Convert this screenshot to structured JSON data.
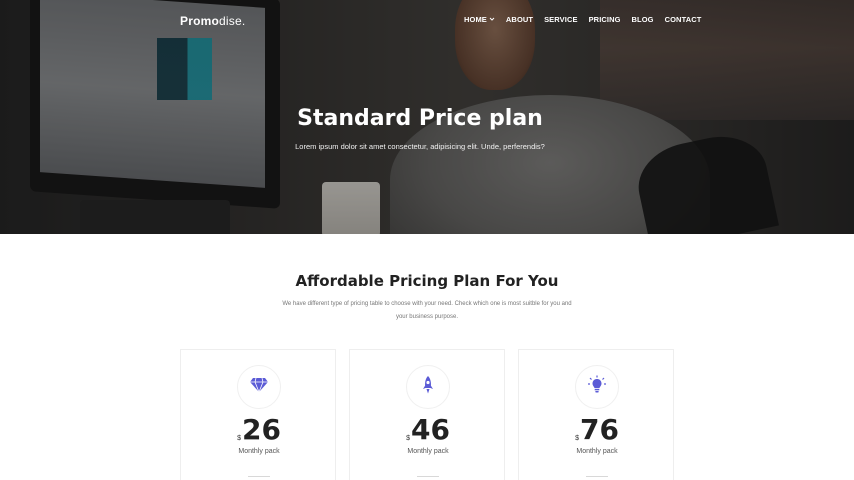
{
  "brand": {
    "logo_bold": "Promo",
    "logo_light": "dise."
  },
  "nav": {
    "items": [
      {
        "label": "HOME",
        "has_dropdown": true
      },
      {
        "label": "ABOUT"
      },
      {
        "label": "SERVICE"
      },
      {
        "label": "PRICING"
      },
      {
        "label": "BLOG"
      },
      {
        "label": "CONTACT"
      }
    ]
  },
  "hero": {
    "title": "Standard Price plan",
    "subtitle": "Lorem ipsum dolor sit amet consectetur, adipisicing elit. Unde, perferendis?"
  },
  "pricing": {
    "title": "Affordable Pricing Plan For You",
    "description_line1": "We have different type of pricing table to choose with your need. Check which one is most suitble for you and",
    "description_line2": "your business purpose.",
    "accent_color": "#5b5bd6",
    "plans": [
      {
        "icon": "diamond-icon",
        "currency": "$",
        "amount": "26",
        "period": "Monthly pack"
      },
      {
        "icon": "rocket-icon",
        "currency": "$",
        "amount": "46",
        "period": "Monthly pack"
      },
      {
        "icon": "lightbulb-icon",
        "currency": "$",
        "amount": "76",
        "period": "Monthly pack"
      }
    ]
  }
}
